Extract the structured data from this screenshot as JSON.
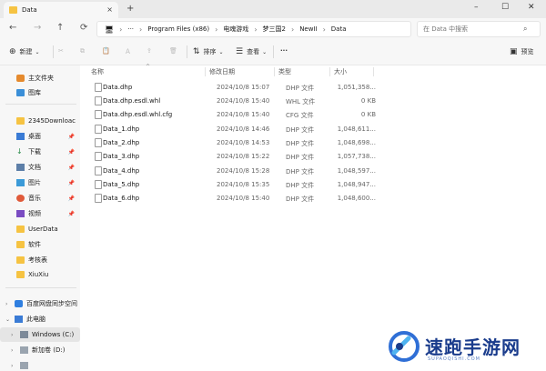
{
  "tab": {
    "title": "Data",
    "close": "×",
    "new_tab": "+"
  },
  "window_controls": {
    "minimize": "–",
    "maximize": "☐",
    "close": "✕"
  },
  "nav": {
    "back": "←",
    "forward": "→",
    "up": "↑",
    "refresh": "⟳"
  },
  "address": {
    "more": "···",
    "segments": [
      "Program Files (x86)",
      "电魂游戏",
      "梦三国2",
      "NewII",
      "Data"
    ]
  },
  "search": {
    "placeholder": "在 Data 中搜索"
  },
  "commands": {
    "new_label": "新建",
    "sort_label": "排序",
    "view_label": "查看",
    "more_label": "···",
    "preview_label": "预览"
  },
  "sidebar": {
    "home": "主文件夹",
    "gallery": "图库",
    "pinned": [
      {
        "label": "2345Downloac",
        "icon": "folder-icon"
      },
      {
        "label": "桌面",
        "icon": "desktop-icon"
      },
      {
        "label": "下载",
        "icon": "download-icon"
      },
      {
        "label": "文档",
        "icon": "document-icon"
      },
      {
        "label": "图片",
        "icon": "picture-icon"
      },
      {
        "label": "音乐",
        "icon": "music-icon"
      },
      {
        "label": "视频",
        "icon": "video-icon"
      }
    ],
    "folders": [
      "UserData",
      "软件",
      "考核表",
      "XiuXiu"
    ],
    "cloud": "百度网盘同步空间",
    "this_pc": "此电脑",
    "drives": [
      "Windows (C:)",
      "新加卷 (D:)"
    ]
  },
  "columns": {
    "name": "名称",
    "date": "修改日期",
    "type": "类型",
    "size": "大小"
  },
  "files": [
    {
      "name": "Data.dhp",
      "date": "2024/10/8 15:07",
      "type": "DHP 文件",
      "size": "1,051,358..."
    },
    {
      "name": "Data.dhp.esdl.whl",
      "date": "2024/10/8 15:40",
      "type": "WHL 文件",
      "size": "0 KB"
    },
    {
      "name": "Data.dhp.esdl.whl.cfg",
      "date": "2024/10/8 15:40",
      "type": "CFG 文件",
      "size": "0 KB"
    },
    {
      "name": "Data_1.dhp",
      "date": "2024/10/8 14:46",
      "type": "DHP 文件",
      "size": "1,048,611..."
    },
    {
      "name": "Data_2.dhp",
      "date": "2024/10/8 14:53",
      "type": "DHP 文件",
      "size": "1,048,698..."
    },
    {
      "name": "Data_3.dhp",
      "date": "2024/10/8 15:22",
      "type": "DHP 文件",
      "size": "1,057,738..."
    },
    {
      "name": "Data_4.dhp",
      "date": "2024/10/8 15:28",
      "type": "DHP 文件",
      "size": "1,048,597..."
    },
    {
      "name": "Data_5.dhp",
      "date": "2024/10/8 15:35",
      "type": "DHP 文件",
      "size": "1,048,947..."
    },
    {
      "name": "Data_6.dhp",
      "date": "2024/10/8 15:40",
      "type": "DHP 文件",
      "size": "1,048,600..."
    }
  ],
  "watermark": {
    "title": "速跑手游网",
    "url": "SUPAOQISHI.COM"
  },
  "colors": {
    "folder": "#f6c342",
    "accent": "#0067c0",
    "watermark": "#1a3c8c"
  }
}
